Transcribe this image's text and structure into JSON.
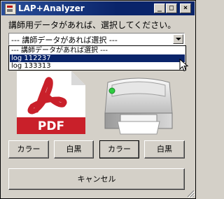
{
  "window": {
    "title": "LAP+Analyzer",
    "minimize_glyph": "_",
    "maximize_glyph": "□",
    "close_glyph": "×"
  },
  "prompt": "講師用データがあれば、選択してください。",
  "combo": {
    "value": "--- 講師データがあれば選択 ---",
    "options": [
      "--- 講師データがあれば選択 ---",
      "log 112237",
      "log 133313"
    ],
    "highlighted_index": 1
  },
  "icons": {
    "pdf": "pdf-file-icon",
    "pdf_label": "PDF",
    "printer": "printer-icon"
  },
  "buttons": {
    "pdf_color": "カラー",
    "pdf_mono": "白黒",
    "print_color": "カラー",
    "print_mono": "白黒",
    "cancel": "キャンセル"
  },
  "colors": {
    "titlebar": "#0a246a",
    "window_bg": "#d4d0c8",
    "selection": "#0a246a",
    "pdf_red": "#c9202a",
    "printer_led": "#2ecc40"
  }
}
